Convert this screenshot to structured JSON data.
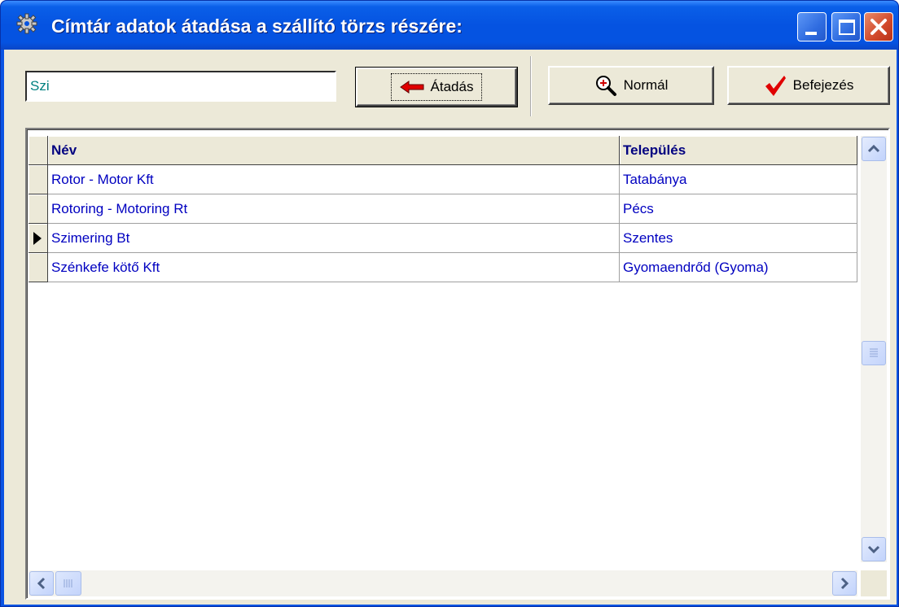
{
  "window": {
    "title": "Címtár adatok átadása a szállító törzs részére:"
  },
  "toolbar": {
    "search_value": "Szi",
    "transfer_label": "Átadás",
    "normal_label": "Normál",
    "finish_label": "Befejezés"
  },
  "grid": {
    "columns": [
      "Név",
      "Település"
    ],
    "rows": [
      {
        "name": "Rotor - Motor Kft",
        "city": "Tatabánya"
      },
      {
        "name": "Rotoring - Motoring Rt",
        "city": "Pécs"
      },
      {
        "name": "Szimering Bt",
        "city": "Szentes"
      },
      {
        "name": "Szénkefe kötő Kft",
        "city": "Gyomaendrőd (Gyoma)"
      }
    ],
    "current_row_index": 2
  },
  "colors": {
    "titlebar": "#0553e1",
    "client_bg": "#ece9d8",
    "cell_text": "#0000c0",
    "header_text": "#000080",
    "input_text": "#008080"
  },
  "icons": {
    "app": "gear-icon",
    "transfer": "red-arrow-left-icon",
    "normal": "zoom-in-magnifier-icon",
    "finish": "red-checkmark-icon"
  }
}
